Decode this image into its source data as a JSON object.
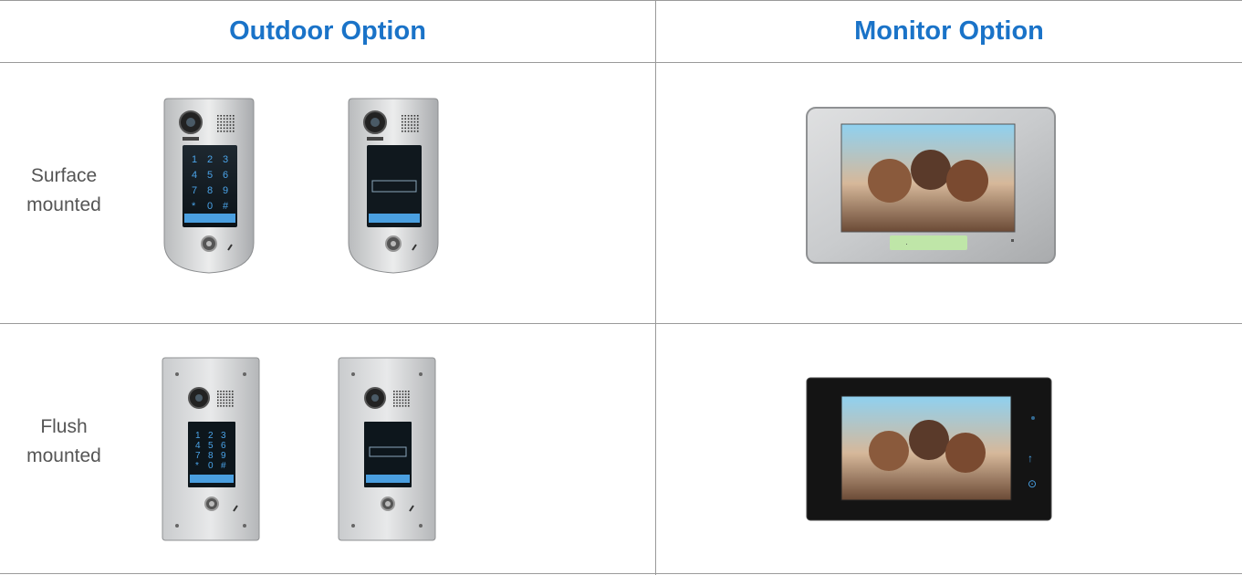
{
  "table": {
    "headers": [
      "Outdoor Option",
      "Monitor Option"
    ],
    "rows": [
      {
        "label_line1": "Surface",
        "label_line2": "mounted",
        "outdoor_products": [
          "surface-keypad-panel-icon",
          "surface-card-reader-panel-icon"
        ],
        "monitor_product": "silver-monitor-icon"
      },
      {
        "label_line1": "Flush",
        "label_line2": "mounted",
        "outdoor_products": [
          "flush-keypad-panel-icon",
          "flush-card-reader-panel-icon"
        ],
        "monitor_product": "black-monitor-icon"
      }
    ],
    "keypad_keys": [
      "1",
      "2",
      "3",
      "4",
      "5",
      "6",
      "7",
      "8",
      "9",
      "*",
      "0",
      "#"
    ],
    "colors": {
      "header_text": "#1a73c8",
      "grid_line": "#9a9a9a",
      "label_text": "#555555"
    }
  }
}
